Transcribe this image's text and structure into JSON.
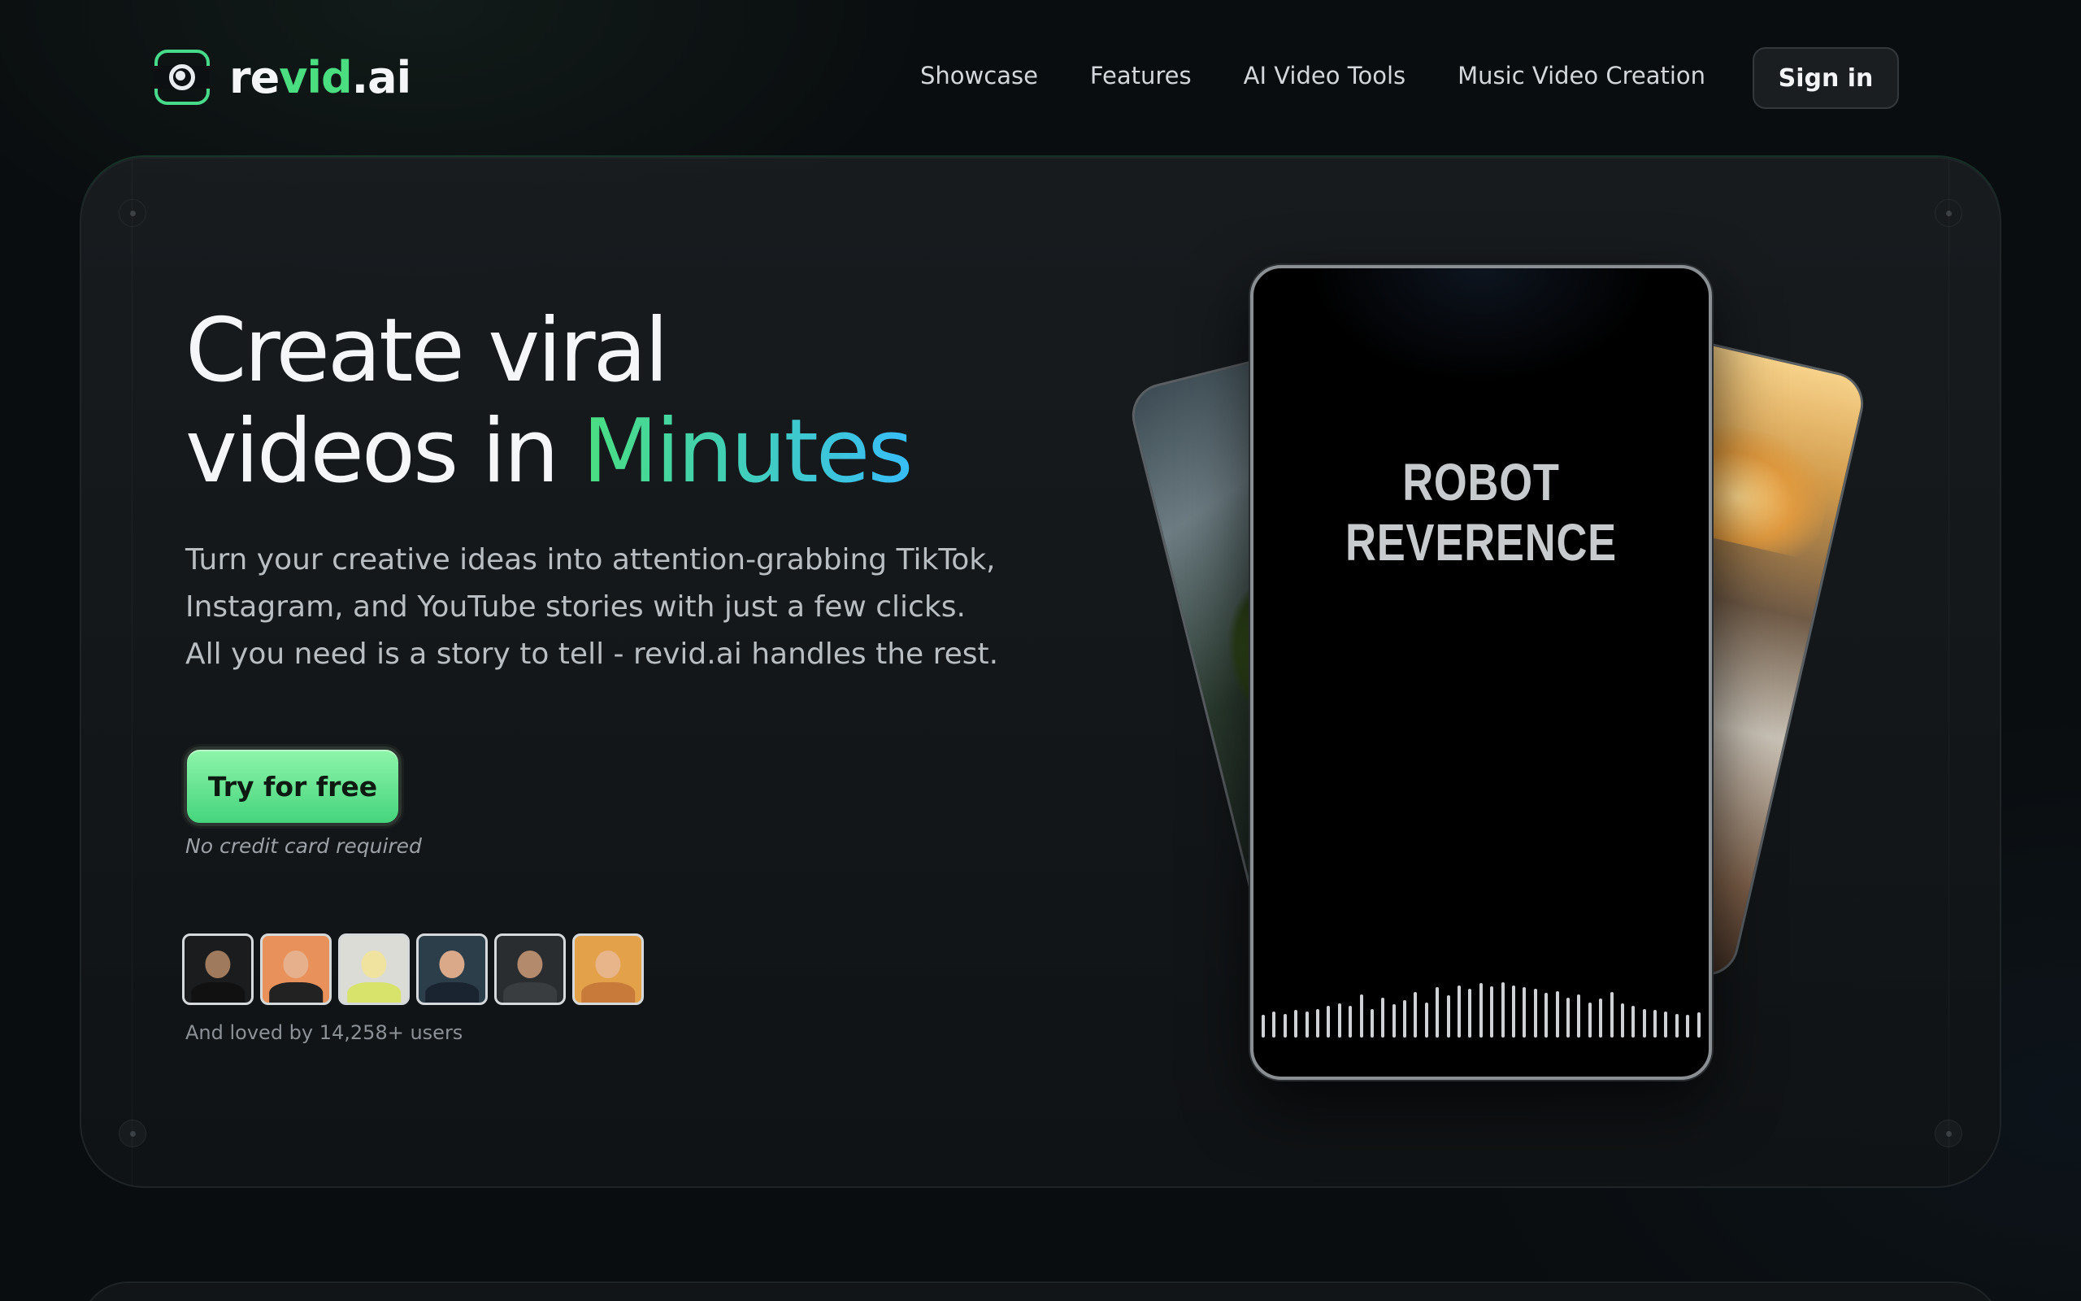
{
  "brand": {
    "name_prefix": "re",
    "name_accent": "vid",
    "name_suffix": ".ai",
    "accent_color": "#4ade80"
  },
  "nav": {
    "links": [
      {
        "label": "Showcase"
      },
      {
        "label": "Features"
      },
      {
        "label": "AI Video Tools"
      },
      {
        "label": "Music Video Creation"
      }
    ],
    "signin_label": "Sign in"
  },
  "hero": {
    "headline_line1": "Create viral",
    "headline_line2_prefix": "videos in ",
    "headline_line2_accent": "Minutes",
    "subtext": "Turn your creative ideas into attention-grabbing TikTok, Instagram, and YouTube stories with just a few clicks. All you need is a story to tell - revid.ai handles the rest.",
    "cta_label": "Try for free",
    "cta_note": "No credit card required",
    "social_proof": "And loved by 14,258+ users",
    "avatars": [
      {
        "name": "avatar-1",
        "bg": "#1a1c1e",
        "skin": "#a07a5c",
        "shirt": "#111"
      },
      {
        "name": "avatar-2",
        "bg": "#e8915a",
        "skin": "#e7b08c",
        "shirt": "#222"
      },
      {
        "name": "avatar-3",
        "bg": "#dcdcd6",
        "skin": "#f0e3a0",
        "shirt": "#d7e36a"
      },
      {
        "name": "avatar-4",
        "bg": "#2c3e4a",
        "skin": "#d9a98a",
        "shirt": "#1a2430"
      },
      {
        "name": "avatar-5",
        "bg": "#2a2d30",
        "skin": "#b48a6d",
        "shirt": "#3a3d40"
      },
      {
        "name": "avatar-6",
        "bg": "#e3a24a",
        "skin": "#e8b48a",
        "shirt": "#c77a3a"
      }
    ]
  },
  "phone": {
    "title": "ROBOT REVERENCE",
    "waveform_levels": [
      0.4,
      0.45,
      0.42,
      0.48,
      0.45,
      0.5,
      0.55,
      0.6,
      0.55,
      0.75,
      0.5,
      0.7,
      0.58,
      0.65,
      0.8,
      0.62,
      0.88,
      0.74,
      0.92,
      0.85,
      0.95,
      0.9,
      0.97,
      0.92,
      0.88,
      0.85,
      0.78,
      0.82,
      0.7,
      0.75,
      0.62,
      0.68,
      0.8,
      0.6,
      0.55,
      0.5,
      0.48,
      0.45,
      0.42,
      0.4,
      0.44
    ]
  }
}
